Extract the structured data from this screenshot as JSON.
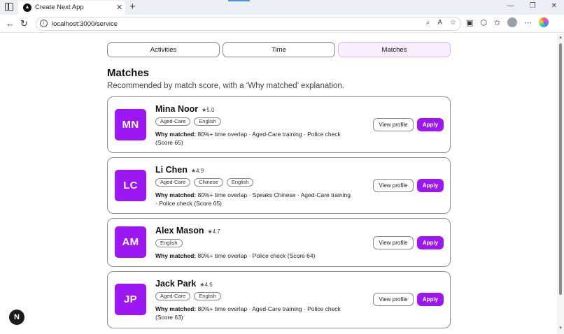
{
  "browser": {
    "tab_title": "Create Next App",
    "tab_favicon": "▲",
    "url": "localhost:3000/service"
  },
  "page": {
    "segments": [
      {
        "label": "Activities"
      },
      {
        "label": "Time"
      },
      {
        "label": "Matches"
      }
    ],
    "title": "Matches",
    "subtitle": "Recommended by match score, with a ‘Why matched’ explanation.",
    "why_label": "Why matched:",
    "view_profile_label": "View profile",
    "apply_label": "Apply"
  },
  "matches": [
    {
      "initials": "MN",
      "name": "Mina Noor",
      "rating": "★5.0",
      "tags": [
        "Aged-Care",
        "English"
      ],
      "why": "80%+ time overlap · Aged-Care training · Police check (Score 65)"
    },
    {
      "initials": "LC",
      "name": "Li Chen",
      "rating": "★4.9",
      "tags": [
        "Aged-Care",
        "Chinese",
        "English"
      ],
      "why": "80%+ time overlap · Speaks Chinese · Aged-Care training · Police check (Score 65)"
    },
    {
      "initials": "AM",
      "name": "Alex Mason",
      "rating": "★4.7",
      "tags": [
        "English"
      ],
      "why": "80%+ time overlap · Police check (Score 64)"
    },
    {
      "initials": "JP",
      "name": "Jack Park",
      "rating": "★4.6",
      "tags": [
        "Aged-Care",
        "English"
      ],
      "why": "80%+ time overlap · Aged-Care training · Police check (Score 63)"
    }
  ],
  "colors": {
    "accent": "#9d17f2",
    "active_segment_bg": "#f8f0fe"
  },
  "next_badge": "N"
}
